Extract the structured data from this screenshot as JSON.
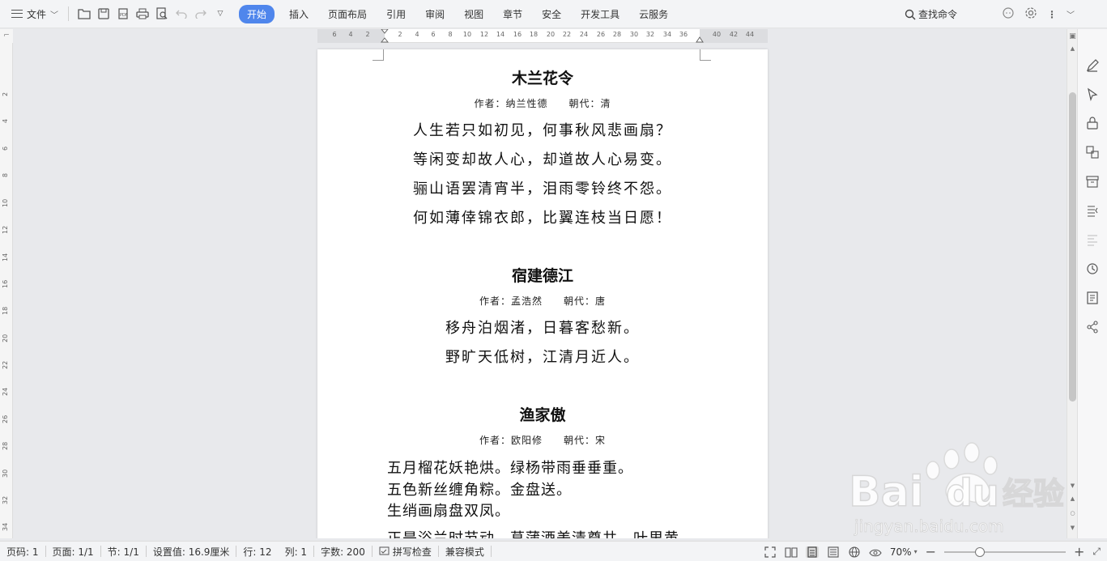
{
  "toolbar": {
    "file_label": "文件",
    "tabs": [
      "开始",
      "插入",
      "页面布局",
      "引用",
      "审阅",
      "视图",
      "章节",
      "安全",
      "开发工具",
      "云服务"
    ],
    "search_label": "查找命令"
  },
  "ruler": {
    "h_numbers": [
      "6",
      "4",
      "2",
      "2",
      "4",
      "6",
      "8",
      "10",
      "12",
      "14",
      "16",
      "18",
      "20",
      "22",
      "24",
      "26",
      "28",
      "30",
      "32",
      "34",
      "36",
      "40",
      "42",
      "44"
    ],
    "v_numbers": [
      "2",
      "4",
      "6",
      "8",
      "10",
      "12",
      "14",
      "16",
      "18",
      "20",
      "22",
      "24",
      "26",
      "28",
      "30",
      "32",
      "34"
    ]
  },
  "document": {
    "poems": [
      {
        "title": "木兰花令",
        "author": "作者：纳兰性德　　朝代：清",
        "lines": [
          "人生若只如初见，何事秋风悲画扇？",
          "等闲变却故人心，却道故人心易变。",
          "骊山语罢清宵半，泪雨零铃终不怨。",
          "何如薄倖锦衣郎，比翼连枝当日愿！"
        ]
      },
      {
        "title": "宿建德江",
        "author": "作者：孟浩然　　朝代：唐",
        "lines": [
          "移舟泊烟渚，日暮客愁新。",
          "野旷天低树，江清月近人。"
        ]
      },
      {
        "title": "渔家傲",
        "author": "作者：欧阳修　　朝代：宋",
        "lines": [
          "五月榴花妖艳烘。绿杨带雨垂垂重。",
          "五色新丝缠角粽。金盘送。",
          "生绡画扇盘双凤。",
          "正是浴兰时节动。菖蒲酒美清尊共。叶里黄"
        ]
      }
    ]
  },
  "statusbar": {
    "page_no": "页码: 1",
    "pages": "页面: 1/1",
    "section": "节: 1/1",
    "setting": "设置值: 16.9厘米",
    "row": "行: 12",
    "col": "列: 1",
    "word_count": "字数: 200",
    "spell_check": "拼写检查",
    "compat_mode": "兼容模式",
    "zoom": "70%"
  },
  "watermark": {
    "brand": "Bai du 经验",
    "url": "jingyan.baidu.com"
  },
  "colors": {
    "accent": "#4f86ec",
    "page_bg": "#ffffff",
    "canvas_bg": "#e8e9ec"
  }
}
